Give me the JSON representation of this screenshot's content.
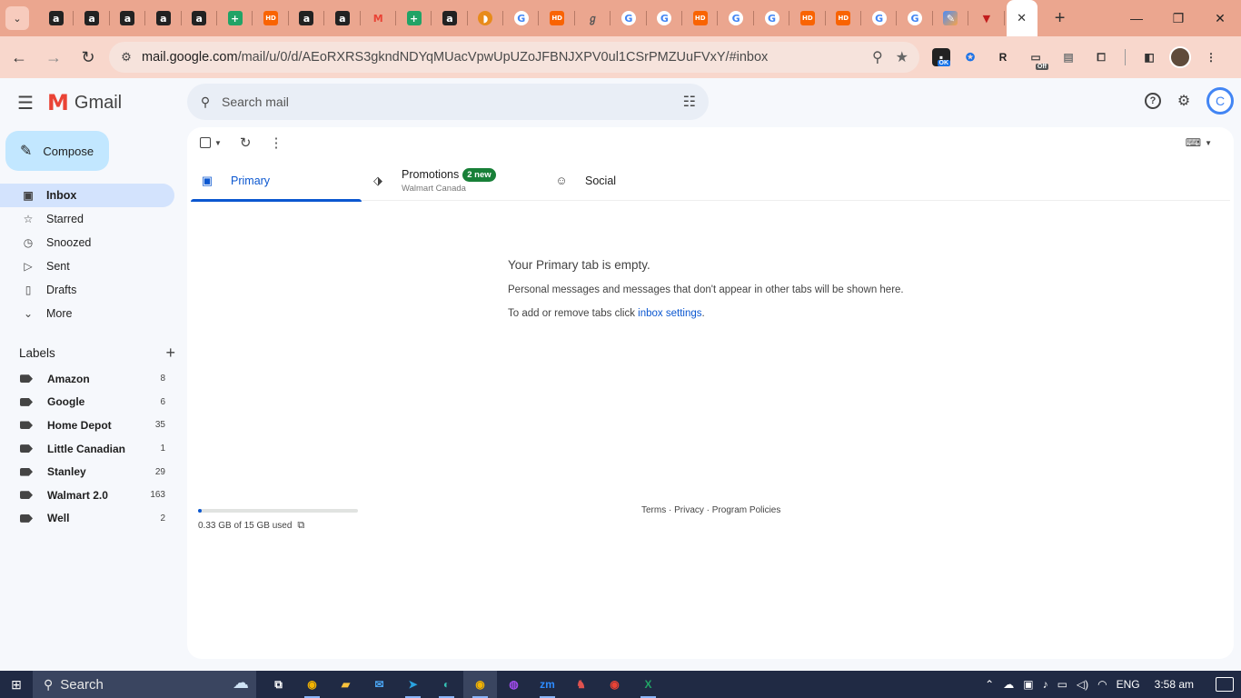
{
  "browser": {
    "tabs": [
      {
        "icon": "amazon-icon",
        "glyph": "a",
        "kind": "amazon"
      },
      {
        "icon": "amazon-icon",
        "glyph": "a",
        "kind": "amazon"
      },
      {
        "icon": "amazon-icon",
        "glyph": "a",
        "kind": "amazon"
      },
      {
        "icon": "amazon-icon",
        "glyph": "a",
        "kind": "amazon"
      },
      {
        "icon": "amazon-icon",
        "glyph": "a",
        "kind": "amazon"
      },
      {
        "icon": "sheets-icon",
        "glyph": "+",
        "kind": "sheets"
      },
      {
        "icon": "home-depot-icon",
        "glyph": "HD",
        "kind": "hd"
      },
      {
        "icon": "amazon-icon",
        "glyph": "a",
        "kind": "amazon"
      },
      {
        "icon": "amazon-icon",
        "glyph": "a",
        "kind": "amazon"
      },
      {
        "icon": "gmail-icon",
        "glyph": "M",
        "kind": "gmail"
      },
      {
        "icon": "sheets-icon",
        "glyph": "+",
        "kind": "sheets"
      },
      {
        "icon": "amazon-icon",
        "glyph": "a",
        "kind": "amazon"
      },
      {
        "icon": "taco-icon",
        "glyph": "◗",
        "kind": "taco"
      },
      {
        "icon": "google-icon",
        "glyph": "G",
        "kind": "google"
      },
      {
        "icon": "home-depot-icon",
        "glyph": "HD",
        "kind": "hd"
      },
      {
        "icon": "stylized-icon",
        "glyph": "ℊ",
        "kind": "misc"
      },
      {
        "icon": "google-icon",
        "glyph": "G",
        "kind": "google"
      },
      {
        "icon": "google-icon",
        "glyph": "G",
        "kind": "google"
      },
      {
        "icon": "home-depot-icon",
        "glyph": "HD",
        "kind": "hd"
      },
      {
        "icon": "google-icon",
        "glyph": "G",
        "kind": "google"
      },
      {
        "icon": "google-icon",
        "glyph": "G",
        "kind": "google"
      },
      {
        "icon": "home-depot-icon",
        "glyph": "HD",
        "kind": "hd"
      },
      {
        "icon": "home-depot-icon",
        "glyph": "HD",
        "kind": "hd"
      },
      {
        "icon": "google-icon",
        "glyph": "G",
        "kind": "google"
      },
      {
        "icon": "google-icon",
        "glyph": "G",
        "kind": "google"
      },
      {
        "icon": "extension-gradient-icon",
        "glyph": "✎",
        "kind": "ext"
      },
      {
        "icon": "red-triangle-icon",
        "glyph": "▼",
        "kind": "red"
      }
    ],
    "url_host": "mail.google.com",
    "url_path": "/mail/u/0/d/AEoRXRS3gkndNDYqMUacVpwUpUZoJFBNJXPV0ul1CSrPMZUuFVxY/#inbox",
    "ext_badge_ok": "OK",
    "ext_badge_off": "Off"
  },
  "gmail": {
    "logo_text": "Gmail",
    "search_placeholder": "Search mail",
    "compose_label": "Compose",
    "nav": [
      {
        "label": "Inbox",
        "icon": "inbox-icon",
        "glyph": "▣"
      },
      {
        "label": "Starred",
        "icon": "star-icon",
        "glyph": "☆"
      },
      {
        "label": "Snoozed",
        "icon": "clock-icon",
        "glyph": "◷"
      },
      {
        "label": "Sent",
        "icon": "send-icon",
        "glyph": "▷"
      },
      {
        "label": "Drafts",
        "icon": "draft-icon",
        "glyph": "▯"
      },
      {
        "label": "More",
        "icon": "chevron-down-icon",
        "glyph": "⌄"
      }
    ],
    "labels_title": "Labels",
    "labels": [
      {
        "name": "Amazon",
        "count": "8"
      },
      {
        "name": "Google",
        "count": "6"
      },
      {
        "name": "Home Depot",
        "count": "35"
      },
      {
        "name": "Little Canadian",
        "count": "1"
      },
      {
        "name": "Stanley",
        "count": "29"
      },
      {
        "name": "Walmart 2.0",
        "count": "163"
      },
      {
        "name": "Well",
        "count": "2"
      }
    ],
    "tabs": {
      "primary": "Primary",
      "promotions": "Promotions",
      "promotions_badge": "2 new",
      "promotions_sub": "Walmart Canada",
      "social": "Social"
    },
    "empty": {
      "title": "Your Primary tab is empty.",
      "line1": "Personal messages and messages that don't appear in other tabs will be shown here.",
      "line2_prefix": "To add or remove tabs click ",
      "line2_link": "inbox settings",
      "line2_suffix": "."
    },
    "storage_text": "0.33 GB of 15 GB used",
    "storage_fraction": 0.022,
    "footer": "Terms · Privacy · Program Policies"
  },
  "taskbar": {
    "search_label": "Search",
    "apps": [
      {
        "icon": "task-view-icon",
        "glyph": "⧉",
        "color": "#ffffff"
      },
      {
        "icon": "chrome-icon",
        "glyph": "◉",
        "color": "#f4b400"
      },
      {
        "icon": "file-explorer-icon",
        "glyph": "▰",
        "color": "#f9c23c"
      },
      {
        "icon": "mail-icon",
        "glyph": "✉",
        "color": "#4aa3f0"
      },
      {
        "icon": "telegram-icon",
        "glyph": "➤",
        "color": "#2aa3e0"
      },
      {
        "icon": "edge-icon",
        "glyph": "◐",
        "color": "#35c1b5"
      },
      {
        "icon": "chrome-icon",
        "glyph": "◉",
        "color": "#f4b400"
      },
      {
        "icon": "messenger-icon",
        "glyph": "◍",
        "color": "#a24cf0"
      },
      {
        "icon": "zoom-icon",
        "glyph": "zm",
        "color": "#2d8cff"
      },
      {
        "icon": "app-icon",
        "glyph": "♞",
        "color": "#e0524f"
      },
      {
        "icon": "chrome-icon",
        "glyph": "◉",
        "color": "#ea4335"
      },
      {
        "icon": "excel-icon",
        "glyph": "X",
        "color": "#21a366"
      }
    ],
    "lang": "ENG",
    "time": "3:58 am"
  }
}
